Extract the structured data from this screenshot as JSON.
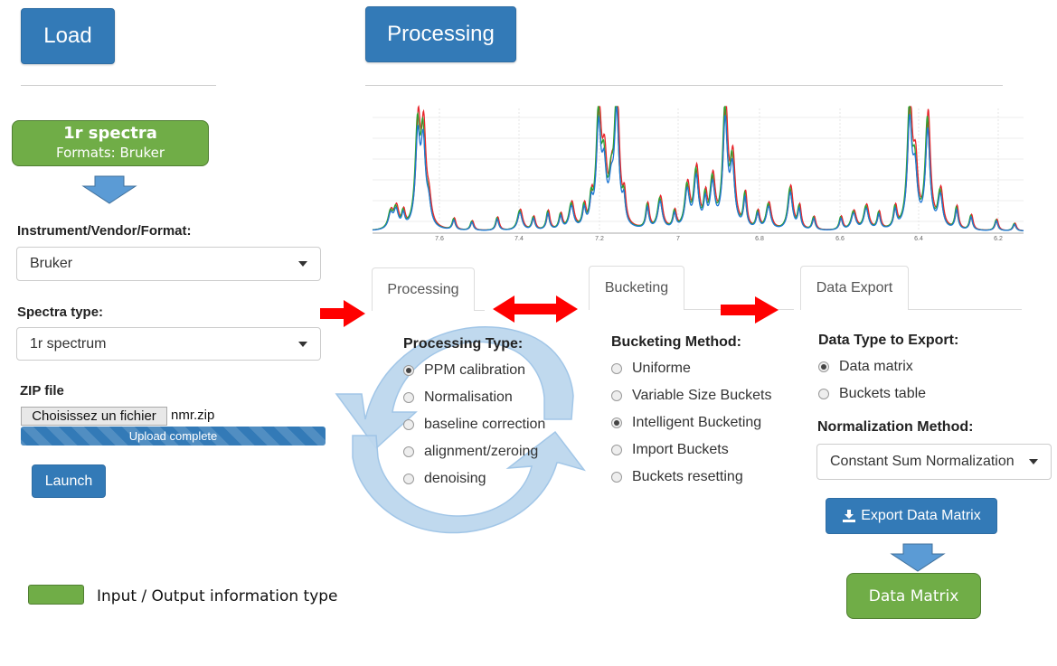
{
  "header": {
    "load_label": "Load",
    "processing_label": "Processing"
  },
  "input_box": {
    "title": "1r spectra",
    "subtitle": "Formats: Bruker"
  },
  "load_panel": {
    "instrument_label": "Instrument/Vendor/Format:",
    "instrument_value": "Bruker",
    "spectra_type_label": "Spectra type:",
    "spectra_type_value": "1r spectrum",
    "zip_label": "ZIP file",
    "file_button_label": "Choisissez un fichier",
    "file_name": "nmr.zip",
    "upload_status": "Upload complete",
    "upload_progress": 100,
    "launch_label": "Launch"
  },
  "spectrum_ticks": [
    "7.6",
    "7.4",
    "7.2",
    "7",
    "6.8",
    "6.6",
    "6.4",
    "6.2"
  ],
  "spectrum_colors": {
    "red": "#e8242a",
    "green": "#2ca02c",
    "blue": "#1f77d4"
  },
  "tabs": [
    {
      "label": "Processing"
    },
    {
      "label": "Bucketing"
    },
    {
      "label": "Data Export"
    }
  ],
  "processing": {
    "title": "Processing Type:",
    "options": [
      "PPM calibration",
      "Normalisation",
      "baseline correction",
      "alignment/zeroing",
      "denoising"
    ],
    "selected": 0
  },
  "bucketing": {
    "title": "Bucketing Method:",
    "options": [
      "Uniforme",
      "Variable Size Buckets",
      "Intelligent Bucketing",
      "Import Buckets",
      "Buckets resetting"
    ],
    "selected": 2
  },
  "export": {
    "title": "Data Type to Export:",
    "options": [
      "Data matrix",
      "Buckets table"
    ],
    "selected": 0,
    "norm_label": "Normalization Method:",
    "norm_value": "Constant Sum Normalization",
    "export_button": "Export Data Matrix"
  },
  "output_box": {
    "title": "Data Matrix"
  },
  "legend": {
    "text": "Input / Output information type"
  },
  "colors": {
    "accent": "#337ab7",
    "green": "#70ad47",
    "arrow_red": "#ff0000",
    "cycle_arrow": "#bdd7ee"
  }
}
